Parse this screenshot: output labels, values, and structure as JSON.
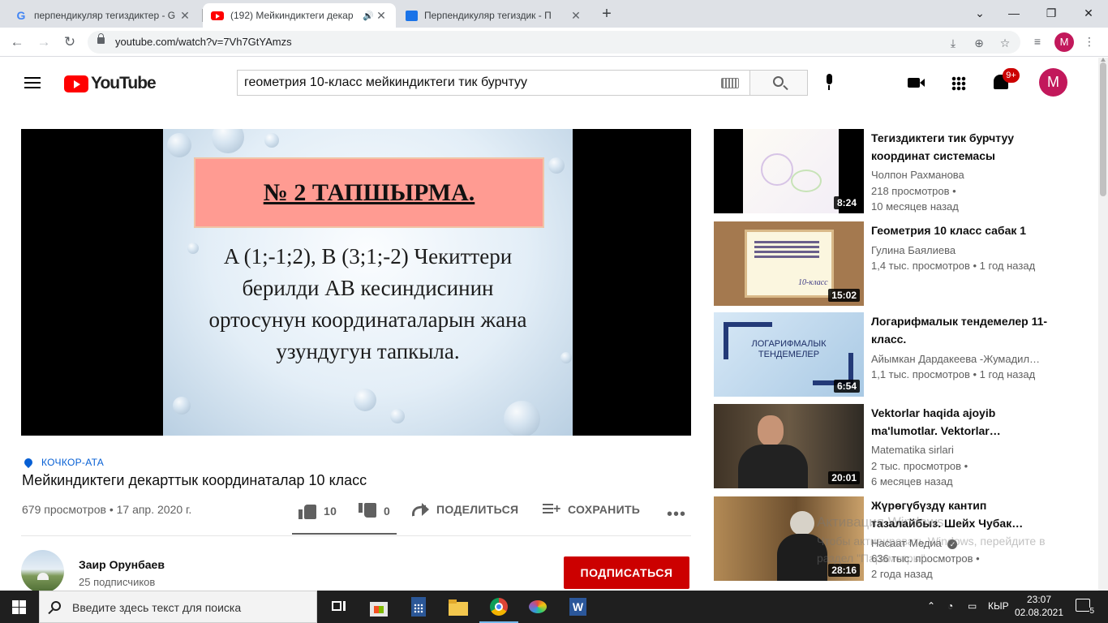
{
  "browser": {
    "tabs": [
      {
        "label": "перпендикуляр тегиздиктер - G",
        "icon": "google-icon",
        "active": false
      },
      {
        "label": "(192) Мейкиндиктеги декар",
        "icon": "youtube-favicon",
        "active": true
      },
      {
        "label": "Перпендикуляр тегиздик - П",
        "icon": "book-icon",
        "active": false
      }
    ],
    "url": "youtube.com/watch?v=7Vh7GtYAmzs",
    "profile_initial": "M"
  },
  "header": {
    "logo_text": "YouTube",
    "search_value": "геометрия 10-класс мейкиндиктеги тик бурчтуу",
    "notification_count": "9+",
    "avatar_initial": "M"
  },
  "video": {
    "slide": {
      "heading": "№ 2 ТАПШЫРМА.",
      "lines": [
        "A (1;-1;2), B (3;1;-2) Чекиттери",
        "берилди AB кесиндисинин",
        "ортосунун координаталарын жана",
        "узундугун тапкыла."
      ]
    },
    "location": "КОЧКОР-АТА",
    "title": "Мейкиндиктеги декарттык координаталар 10 класс",
    "meta": "679 просмотров • 17 апр. 2020 г.",
    "likes": "10",
    "dislikes": "0",
    "share_label": "ПОДЕЛИТЬСЯ",
    "save_label": "СОХРАНИТЬ",
    "more_label": "•••",
    "like_ratio": 1.0
  },
  "channel": {
    "name": "Заир Орунбаев",
    "subscribers": "25 подписчиков",
    "subscribe_label": "ПОДПИСАТЬСЯ"
  },
  "recommendations": [
    {
      "title": "Тегиздиктеги тик бурчтуу координат системасы",
      "channel": "Чолпон Рахманова",
      "stats1": "218 просмотров •",
      "stats2": "10 месяцев назад",
      "duration": "8:24"
    },
    {
      "title": "Геометрия 10 класс сабак 1",
      "channel": "Гулина Баялиева",
      "stats1": "1,4 тыс. просмотров • 1 год назад",
      "stats2": "",
      "duration": "15:02",
      "thumb_text": "10-класс"
    },
    {
      "title": "Логарифмалык тендемелер 11-класс.",
      "channel": "Айымкан Дардакеева -Жумадил…",
      "stats1": "1,1 тыс. просмотров • 1 год назад",
      "stats2": "",
      "duration": "6:54",
      "thumb_text": "ЛОГАРИФМАЛЫК ТЕНДЕМЕЛЕР"
    },
    {
      "title": "Vektorlar haqida ajoyib ma'lumotlar. Vektorlar…",
      "channel": "Matematika sirlari",
      "stats1": "2 тыс. просмотров •",
      "stats2": "6 месяцев назад",
      "duration": "20:01"
    },
    {
      "title": "Жүрөгүбүздү кантип тазалайбыз. Шейх Чубак…",
      "channel": "Насаат Медиа",
      "stats1": "636 тыс. просмотров •",
      "stats2": "2 года назад",
      "duration": "28:16"
    }
  ],
  "watermark": {
    "line1": "Активация Windows",
    "line2": "Чтобы активировать Windows, перейдите в раздел \"Параметры\"."
  },
  "taskbar": {
    "search_placeholder": "Введите здесь текст для поиска",
    "lang": "КЫР",
    "time": "23:07",
    "date": "02.08.2021",
    "notif_count": "5"
  },
  "colors": {
    "youtube_red": "#ff0000",
    "subscribe_red": "#cc0000",
    "link_blue": "#065fd4",
    "slide_heading_bg": "#ff9b92"
  }
}
